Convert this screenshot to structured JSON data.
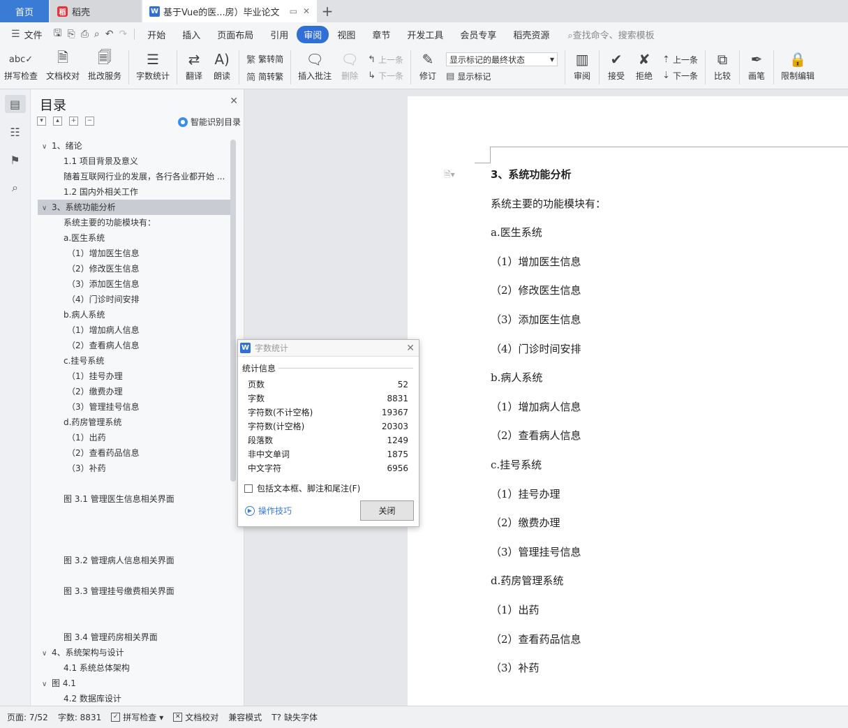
{
  "tabs": {
    "home": "首页",
    "daoke": "稻壳",
    "document": "基于Vue的医...房）毕业论文"
  },
  "menu": {
    "file": "文件",
    "items": [
      "开始",
      "插入",
      "页面布局",
      "引用",
      "审阅",
      "视图",
      "章节",
      "开发工具",
      "会员专享",
      "稻壳资源"
    ],
    "active": "审阅",
    "search": "查找命令、搜索模板"
  },
  "ribbon": {
    "spell_check": "拼写检查",
    "doc_proof": "文档校对",
    "review_service": "批改服务",
    "word_count": "字数统计",
    "translate": "翻译",
    "read_aloud": "朗读",
    "trad_to_simp": "繁转简",
    "simp_to_trad": "简转繁",
    "insert_comment": "插入批注",
    "delete": "删除",
    "prev_comment": "上一条",
    "next_comment": "下一条",
    "track_changes": "修订",
    "markup_select": "显示标记的最终状态",
    "show_markup": "显示标记",
    "review": "审阅",
    "accept": "接受",
    "reject": "拒绝",
    "prev_change": "上一条",
    "next_change": "下一条",
    "compare": "比较",
    "pen": "画笔",
    "restrict": "限制编辑"
  },
  "toc": {
    "title": "目录",
    "smart": "智能识别目录",
    "items": [
      {
        "text": "1、绪论",
        "level": 1,
        "chev": "∨"
      },
      {
        "text": "1.1 项目背景及意义",
        "level": 2
      },
      {
        "text": "随着互联网行业的发展，各行各业都开始 ...",
        "level": 2
      },
      {
        "text": "1.2 国内外相关工作",
        "level": 2
      },
      {
        "text": "3、系统功能分析",
        "level": 1,
        "chev": "∨",
        "selected": true
      },
      {
        "text": "系统主要的功能模块有：",
        "level": 2
      },
      {
        "text": "a.医生系统",
        "level": 2
      },
      {
        "text": "（1）增加医生信息",
        "level": 3
      },
      {
        "text": "（2）修改医生信息",
        "level": 3
      },
      {
        "text": "（3）添加医生信息",
        "level": 3
      },
      {
        "text": "（4）门诊时间安排",
        "level": 3
      },
      {
        "text": "b.病人系统",
        "level": 2
      },
      {
        "text": "（1）增加病人信息",
        "level": 3
      },
      {
        "text": "（2）查看病人信息",
        "level": 3
      },
      {
        "text": "c.挂号系统",
        "level": 2
      },
      {
        "text": "（1）挂号办理",
        "level": 3
      },
      {
        "text": "（2）缴费办理",
        "level": 3
      },
      {
        "text": "（3）管理挂号信息",
        "level": 3
      },
      {
        "text": "d.药房管理系统",
        "level": 2
      },
      {
        "text": "（1）出药",
        "level": 3
      },
      {
        "text": "（2）查看药品信息",
        "level": 3
      },
      {
        "text": "（3）补药",
        "level": 3
      },
      {
        "text": "",
        "level": 2
      },
      {
        "text": "图 3.1 管理医生信息相关界面",
        "level": 2
      },
      {
        "text": "",
        "level": 2
      },
      {
        "text": "",
        "level": 2
      },
      {
        "text": "",
        "level": 2
      },
      {
        "text": "图 3.2 管理病人信息相关界面",
        "level": 2
      },
      {
        "text": "",
        "level": 2
      },
      {
        "text": "图 3.3 管理挂号缴费相关界面",
        "level": 2
      },
      {
        "text": "",
        "level": 2
      },
      {
        "text": "",
        "level": 2
      },
      {
        "text": "图 3.4 管理药房相关界面",
        "level": 2
      },
      {
        "text": "4、系统架构与设计",
        "level": 1,
        "chev": "∨"
      },
      {
        "text": "4.1 系统总体架构",
        "level": 2
      },
      {
        "text": "图 4.1",
        "level": 1,
        "chev": "∨"
      },
      {
        "text": "4.2 数据库设计",
        "level": 2
      }
    ]
  },
  "document": {
    "lines": [
      {
        "text": "3、系统功能分析",
        "heading": true
      },
      {
        "text": "系统主要的功能模块有："
      },
      {
        "text": "a.医生系统"
      },
      {
        "text": "（1）增加医生信息"
      },
      {
        "text": "（2）修改医生信息"
      },
      {
        "text": "（3）添加医生信息"
      },
      {
        "text": "（4）门诊时间安排"
      },
      {
        "text": "b.病人系统"
      },
      {
        "text": "（1）增加病人信息"
      },
      {
        "text": "（2）查看病人信息"
      },
      {
        "text": "c.挂号系统"
      },
      {
        "text": "（1）挂号办理"
      },
      {
        "text": "（2）缴费办理"
      },
      {
        "text": "（3）管理挂号信息"
      },
      {
        "text": "d.药房管理系统"
      },
      {
        "text": "（1）出药"
      },
      {
        "text": "（2）查看药品信息"
      },
      {
        "text": "（3）补药"
      }
    ]
  },
  "dialog": {
    "title": "字数统计",
    "section": "统计信息",
    "stats": [
      {
        "label": "页数",
        "value": "52"
      },
      {
        "label": "字数",
        "value": "8831"
      },
      {
        "label": "字符数(不计空格)",
        "value": "19367"
      },
      {
        "label": "字符数(计空格)",
        "value": "20303"
      },
      {
        "label": "段落数",
        "value": "1249"
      },
      {
        "label": "非中文单词",
        "value": "1875"
      },
      {
        "label": "中文字符",
        "value": "6956"
      }
    ],
    "checkbox": "包括文本框、脚注和尾注(F)",
    "tips": "操作技巧",
    "close": "关闭"
  },
  "status": {
    "page": "页面: 7/52",
    "words": "字数: 8831",
    "spell": "拼写检查",
    "proof": "文档校对",
    "compat": "兼容模式",
    "missing_font": "缺失字体"
  }
}
